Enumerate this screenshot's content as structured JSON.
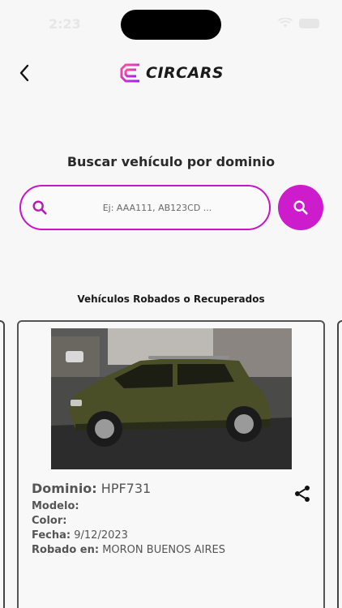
{
  "status_bar": {
    "time": "2:23"
  },
  "header": {
    "logo_text": "CIRCARS"
  },
  "search": {
    "title": "Buscar vehículo por dominio",
    "placeholder": "Ej: AAA111, AB123CD ..."
  },
  "section": {
    "title": "Vehículos Robados o Recuperados"
  },
  "vehicle": {
    "dominio_label": "Dominio:",
    "dominio_value": "HPF731",
    "modelo_label": "Modelo:",
    "modelo_value": "",
    "color_label": "Color:",
    "color_value": "",
    "fecha_label": "Fecha:",
    "fecha_value": "9/12/2023",
    "robado_label": "Robado en:",
    "robado_value": "MORON BUENOS AIRES"
  },
  "colors": {
    "accent": "#cc1ccc",
    "accent_border": "#c715c7"
  },
  "icons": {
    "back": "chevron-left-icon",
    "search_field": "search-icon",
    "search_button": "search-icon",
    "share": "share-icon"
  }
}
